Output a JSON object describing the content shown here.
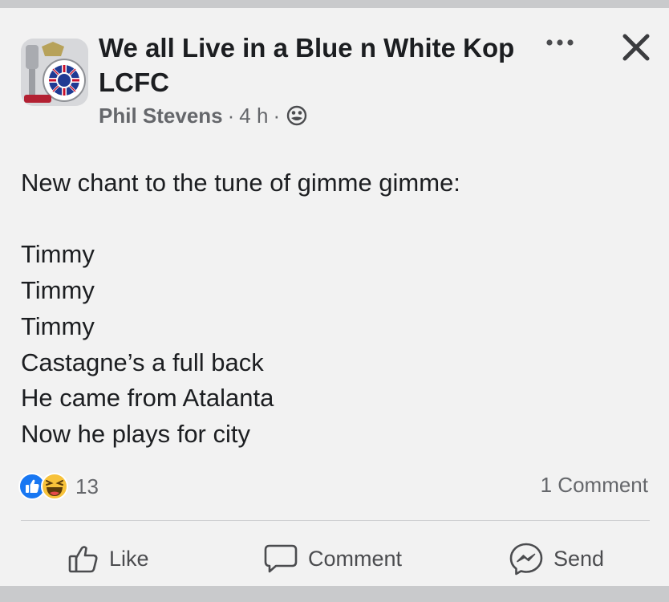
{
  "post": {
    "group_name": "We all Live in a Blue n White Kop LCFC",
    "author": "Phil Stevens",
    "time": "4 h",
    "separator": "·",
    "privacy_icon": "globe-icon",
    "menu_icon": "more-options-icon",
    "close_icon": "close-icon",
    "lines": [
      "New chant to the tune of gimme gimme:",
      "",
      "Timmy",
      "Timmy",
      "Timmy",
      "Castagne’s a full back",
      "He came from Atalanta",
      "Now he plays for city"
    ]
  },
  "engagement": {
    "reaction_icons": [
      "like-reaction-icon",
      "haha-reaction-icon"
    ],
    "reaction_count": "13",
    "comment_count": "1 Comment"
  },
  "actions": {
    "like_label": "Like",
    "comment_label": "Comment",
    "send_label": "Send"
  },
  "colors": {
    "card_background": "#f2f2f2",
    "outer_background": "#c9cacc",
    "primary_text": "#1c1e21",
    "secondary_text": "#65676b",
    "like_blue": "#1877f2",
    "haha_yellow": "#f7c23a"
  }
}
